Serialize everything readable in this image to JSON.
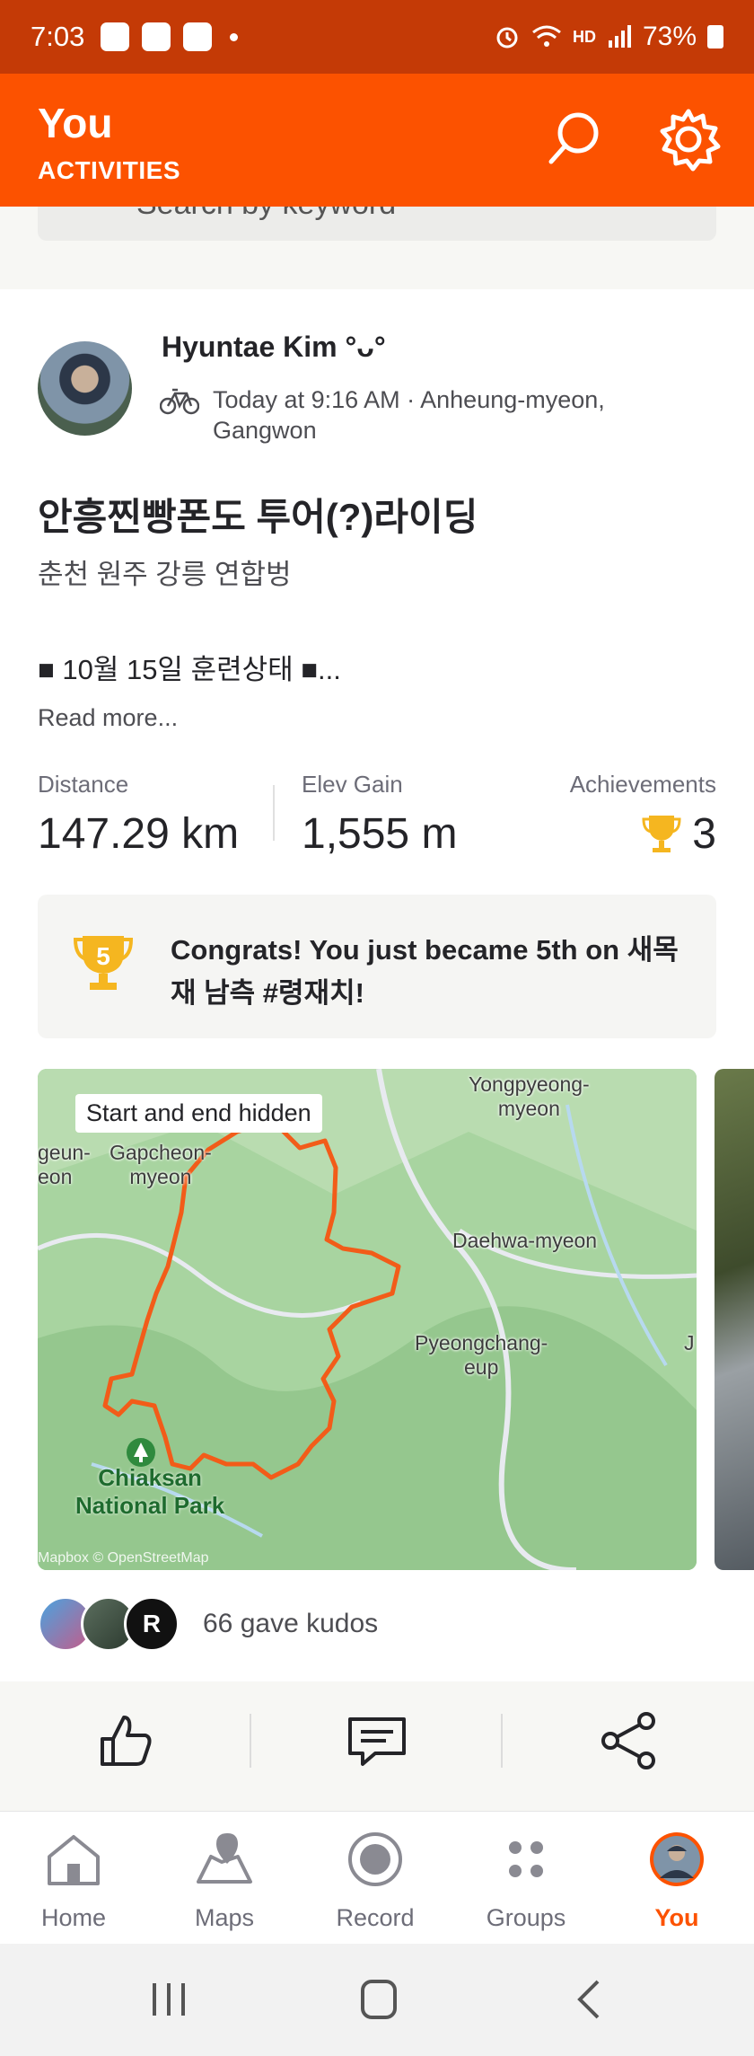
{
  "status": {
    "time": "7:03",
    "battery": "73%",
    "hd": "HD"
  },
  "header": {
    "title": "You",
    "subtitle": "ACTIVITIES"
  },
  "search": {
    "placeholder": "Search by keyword"
  },
  "activity": {
    "athlete": "Hyuntae Kim °ᴗ°",
    "meta": "Today at 9:16 AM · Anheung-myeon, Gangwon",
    "title": "안흥찐빵폰도 투어(?)라이딩",
    "description_line1": "춘천 원주 강릉 연합벙",
    "description_line2": "■ 10월 15일 훈련상태 ■...",
    "read_more": "Read more...",
    "stats": [
      {
        "label": "Distance",
        "value": "147.29 km"
      },
      {
        "label": "Elev Gain",
        "value": "1,555 m"
      },
      {
        "label": "Achievements",
        "value": "3"
      }
    ],
    "congrats": "Congrats! You just became 5th on 새목재 남측 #령재치!",
    "congrats_rank": "5",
    "map": {
      "hidden_label": "Start and end hidden",
      "places": [
        "Yongpyeong-\nmyeon",
        "geun-\neon",
        "Gapcheon-\nmyeon",
        "Daehwa-myeon",
        "Pyeongchang-\neup",
        "J"
      ],
      "park": "Chiaksan\nNational Park",
      "attribution": "Mapbox © OpenStreetMap"
    },
    "kudos": "66 gave kudos"
  },
  "tabs": [
    {
      "label": "Home",
      "icon": "home-icon"
    },
    {
      "label": "Maps",
      "icon": "map-icon"
    },
    {
      "label": "Record",
      "icon": "record-icon"
    },
    {
      "label": "Groups",
      "icon": "groups-icon"
    },
    {
      "label": "You",
      "icon": "avatar-icon",
      "active": true
    }
  ],
  "colors": {
    "accent": "#fc5200",
    "statusbar": "#c43a06",
    "route": "#f25c19",
    "trophy": "#f5b620"
  }
}
